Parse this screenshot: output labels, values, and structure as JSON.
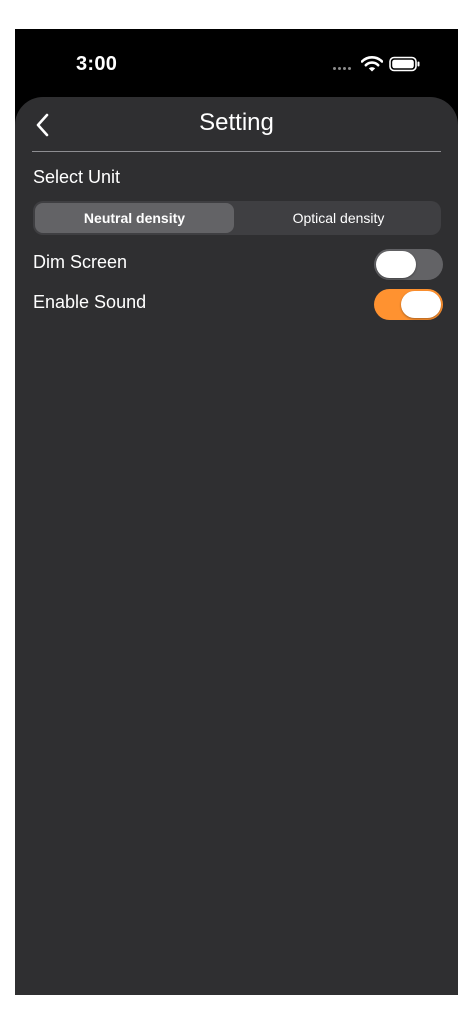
{
  "status_bar": {
    "time": "3:00",
    "icons": [
      "signal-dots-icon",
      "wifi-icon",
      "battery-icon"
    ]
  },
  "nav": {
    "title": "Setting",
    "back_icon": "chevron-left-icon"
  },
  "unit": {
    "label": "Select Unit",
    "options": [
      "Neutral density",
      "Optical density"
    ],
    "selected": "Neutral density"
  },
  "settings": {
    "dim_screen": {
      "label": "Dim Screen",
      "on": false
    },
    "enable_sound": {
      "label": "Enable Sound",
      "on": true
    }
  },
  "colors": {
    "background": "#2f2f31",
    "segment_selected": "#636366",
    "toggle_off": "#636366",
    "toggle_on": "#ff9230"
  }
}
